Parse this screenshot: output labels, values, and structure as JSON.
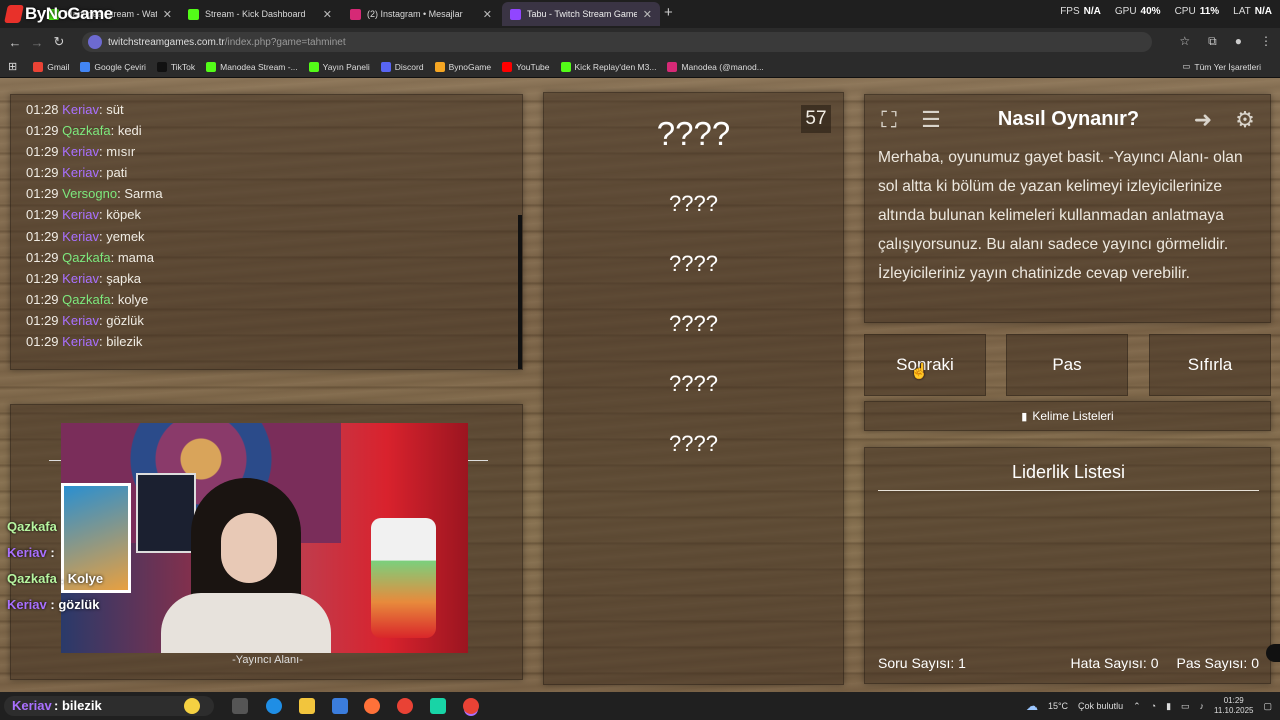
{
  "brand": "ByNoGame",
  "tabs": [
    {
      "label": "Manodea Stream - Watch Live",
      "favicon_color": "#53fc18"
    },
    {
      "label": "Stream - Kick Dashboard",
      "favicon_color": "#53fc18"
    },
    {
      "label": "(2) Instagram • Mesajlar",
      "favicon_color": "#d62976"
    },
    {
      "label": "Tabu - Twitch Stream Game",
      "favicon_color": "#9146ff"
    }
  ],
  "sys": {
    "fps_label": "FPS",
    "fps_val": "N/A",
    "gpu_label": "GPU",
    "gpu_val": "40%",
    "cpu_label": "CPU",
    "cpu_val": "11%",
    "lat_label": "LAT",
    "lat_val": "N/A"
  },
  "url": {
    "host": "twitchstreamgames.com.tr",
    "path": "/index.php?game=tahminet"
  },
  "bookmarks": [
    {
      "label": "Gmail",
      "color": "#ea4335"
    },
    {
      "label": "Google Çeviri",
      "color": "#4285f4"
    },
    {
      "label": "TikTok",
      "color": "#111111"
    },
    {
      "label": "Manodea Stream -...",
      "color": "#53fc18"
    },
    {
      "label": "Yayın Paneli",
      "color": "#53fc18"
    },
    {
      "label": "Discord",
      "color": "#5865f2"
    },
    {
      "label": "BynoGame",
      "color": "#f5a623"
    },
    {
      "label": "YouTube",
      "color": "#ff0000"
    },
    {
      "label": "Kick Replay'den M3...",
      "color": "#53fc18"
    },
    {
      "label": "Manodea (@manod...",
      "color": "#d62976"
    }
  ],
  "all_bookmarks": "Tüm Yer İşaretleri",
  "chat": [
    {
      "time": "01:28",
      "user": "Keriav",
      "color": "#a970ff",
      "msg": "süt"
    },
    {
      "time": "01:29",
      "user": "Qazkafa",
      "color": "#7de87d",
      "msg": "kedi"
    },
    {
      "time": "01:29",
      "user": "Keriav",
      "color": "#a970ff",
      "msg": "mısır"
    },
    {
      "time": "01:29",
      "user": "Keriav",
      "color": "#a970ff",
      "msg": "pati"
    },
    {
      "time": "01:29",
      "user": "Versogno",
      "color": "#7de87d",
      "msg": "Sarma"
    },
    {
      "time": "01:29",
      "user": "Keriav",
      "color": "#a970ff",
      "msg": "köpek"
    },
    {
      "time": "01:29",
      "user": "Keriav",
      "color": "#a970ff",
      "msg": "yemek"
    },
    {
      "time": "01:29",
      "user": "Qazkafa",
      "color": "#7de87d",
      "msg": "mama"
    },
    {
      "time": "01:29",
      "user": "Keriav",
      "color": "#a970ff",
      "msg": "şapka"
    },
    {
      "time": "01:29",
      "user": "Qazkafa",
      "color": "#7de87d",
      "msg": "kolye"
    },
    {
      "time": "01:29",
      "user": "Keriav",
      "color": "#a970ff",
      "msg": "gözlük"
    },
    {
      "time": "01:29",
      "user": "Keriav",
      "color": "#a970ff",
      "msg": "bilezik"
    }
  ],
  "streamer_label": "-Yayıncı Alanı-",
  "overlay_chat": [
    {
      "user": "Qazkafa",
      "color": "#b6f5a0",
      "msg": ""
    },
    {
      "user": "Keriav",
      "color": "#a970ff",
      "msg": ":"
    },
    {
      "user": "Qazkafa",
      "color": "#b6f5a0",
      "msg": ". Kolye"
    },
    {
      "user": "Keriav",
      "color": "#a970ff",
      "msg": ": gözlük"
    },
    {
      "user": "Keriav",
      "color": "#a970ff",
      "msg": ": bilezik"
    }
  ],
  "game": {
    "timer": "57",
    "main_word": "????",
    "forbidden": [
      "????",
      "????",
      "????",
      "????",
      "????"
    ]
  },
  "howto": {
    "title": "Nasıl Oynanır?",
    "text": "Merhaba, oyunumuz gayet basit. -Yayıncı Alanı- olan sol altta ki bölüm de yazan kelimeyi izleyicilerinize altında bulunan kelimeleri kullanmadan anlatmaya çalışıyorsunuz. Bu alanı sadece yayıncı görmelidir. İzleyicileriniz yayın chatinizde cevap verebilir."
  },
  "buttons": {
    "next": "Sonraki",
    "pass": "Pas",
    "reset": "Sıfırla",
    "lists": "Kelime Listeleri"
  },
  "leaderboard": {
    "title": "Liderlik Listesi",
    "question_label": "Soru Sayısı:",
    "question_val": "1",
    "error_label": "Hata Sayısı:",
    "error_val": "0",
    "pass_label": "Pas Sayısı:",
    "pass_val": "0"
  },
  "taskbar": {
    "search_text": "bilezik",
    "weather": "15°C",
    "weather_desc": "Çok bulutlu",
    "time": "01:29",
    "date": "11.10.2025"
  }
}
